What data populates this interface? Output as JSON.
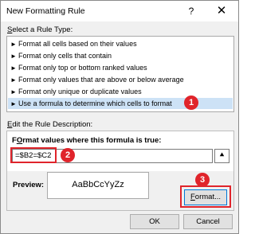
{
  "window": {
    "title": "New Formatting Rule",
    "help_glyph": "?",
    "close_glyph": "✕"
  },
  "rule_type": {
    "label_u": "S",
    "label_rest": "elect a Rule Type:",
    "items": [
      {
        "arrow": "►",
        "label": "Format all cells based on their values"
      },
      {
        "arrow": "►",
        "label": "Format only cells that contain"
      },
      {
        "arrow": "►",
        "label": "Format only top or bottom ranked values"
      },
      {
        "arrow": "►",
        "label": "Format only values that are above or below average"
      },
      {
        "arrow": "►",
        "label": "Format only unique or duplicate values"
      },
      {
        "arrow": "►",
        "label": "Use a formula to determine which cells to format",
        "selected": true
      }
    ]
  },
  "description": {
    "label_u": "E",
    "label_rest": "dit the Rule Description:",
    "formula_label_u": "O",
    "formula_label_pre": "F",
    "formula_label_rest": "rmat values where this formula is true:",
    "formula_value": "=$B2=$C2",
    "ref_glyph": "⯅",
    "preview_label": "Preview:",
    "preview_text": "AaBbCcYyZz",
    "format_button_u": "F",
    "format_button_rest": "ormat..."
  },
  "buttons": {
    "ok": "OK",
    "cancel": "Cancel"
  },
  "annotations": {
    "badge1": "1",
    "badge2": "2",
    "badge3": "3",
    "color": "#e0242b"
  }
}
